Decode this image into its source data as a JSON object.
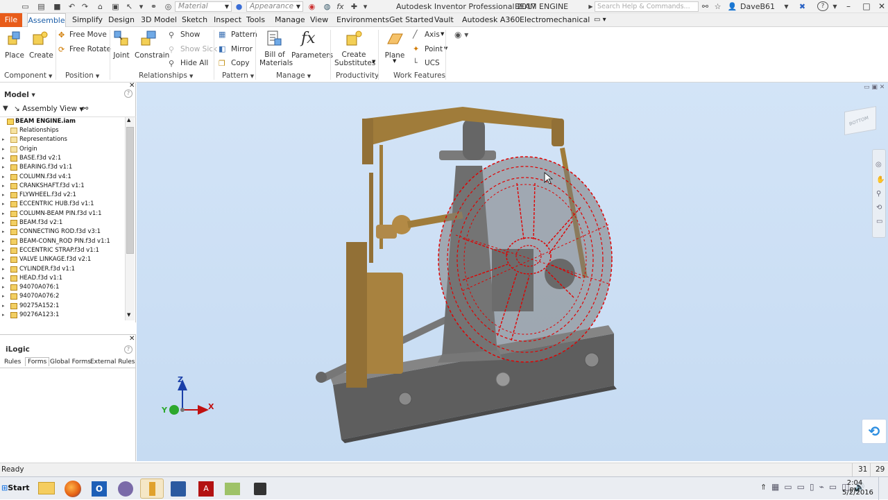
{
  "titlebar": {
    "material_placeholder": "Material",
    "appearance_placeholder": "Appearance",
    "app_title": "Autodesk Inventor Professional 2017",
    "document_title": "BEAM ENGINE",
    "search_placeholder": "Search Help & Commands...",
    "user_name": "DaveB61",
    "help_label": "?"
  },
  "tabs": [
    "File",
    "Assemble",
    "Simplify",
    "Design",
    "3D Model",
    "Sketch",
    "Inspect",
    "Tools",
    "Manage",
    "View",
    "Environments",
    "Get Started",
    "Vault",
    "Autodesk A360",
    "Electromechanical"
  ],
  "ribbon": {
    "component": {
      "place": "Place",
      "create": "Create",
      "panel": "Component"
    },
    "position": {
      "free_move": "Free Move",
      "free_rotate": "Free Rotate",
      "panel": "Position"
    },
    "relationships": {
      "joint": "Joint",
      "constrain": "Constrain",
      "show": "Show",
      "show_sick": "Show Sick",
      "hide_all": "Hide All",
      "panel": "Relationships"
    },
    "pattern": {
      "pattern": "Pattern",
      "mirror": "Mirror",
      "copy": "Copy",
      "panel": "Pattern"
    },
    "manage": {
      "bom_line1": "Bill of",
      "bom_line2": "Materials",
      "parameters": "Parameters",
      "panel": "Manage"
    },
    "productivity": {
      "create_line1": "Create",
      "create_line2": "Substitutes",
      "panel": "Productivity"
    },
    "work_features": {
      "plane": "Plane",
      "axis": "Axis",
      "point": "Point",
      "ucs": "UCS",
      "panel": "Work Features"
    }
  },
  "model_panel": {
    "title": "Model",
    "view_label": "Assembly View",
    "root": "BEAM ENGINE.iam",
    "items": [
      "Relationships",
      "Representations",
      "Origin",
      "BASE.f3d v2:1",
      "BEARING.f3d v1:1",
      "COLUMN.f3d v4:1",
      "CRANKSHAFT.f3d v1:1",
      "FLYWHEEL.f3d v2:1",
      "ECCENTRIC HUB.f3d v1:1",
      "COLUMN-BEAM PIN.f3d v1:1",
      "BEAM.f3d v2:1",
      "CONNECTING ROD.f3d v3:1",
      "BEAM-CONN_ROD PIN.f3d v1:1",
      "ECCENTRIC STRAP.f3d v1:1",
      "VALVE LINKAGE.f3d v2:1",
      "CYLINDER.f3d v1:1",
      "HEAD.f3d v1:1",
      "94070A076:1",
      "94070A076:2",
      "90275A152:1",
      "90276A123:1"
    ]
  },
  "ilogic": {
    "title": "iLogic",
    "tabs": [
      "Rules",
      "Forms",
      "Global Forms",
      "External Rules"
    ]
  },
  "viewport": {
    "axis_z": "Z",
    "axis_y": "Y",
    "axis_x": "X",
    "viewcube_label": "BOTTOM"
  },
  "status": {
    "text": "Ready",
    "count1": "31",
    "count2": "29"
  },
  "taskbar": {
    "start": "Start",
    "time": "2:04 PM",
    "date": "5/2/2016"
  },
  "colors": {
    "file_tab": "#e85c1a",
    "accent": "#1b5ea8",
    "part_brass": "#a07c3a",
    "part_gray": "#6c6c6c",
    "highlight_red": "#e00000"
  }
}
